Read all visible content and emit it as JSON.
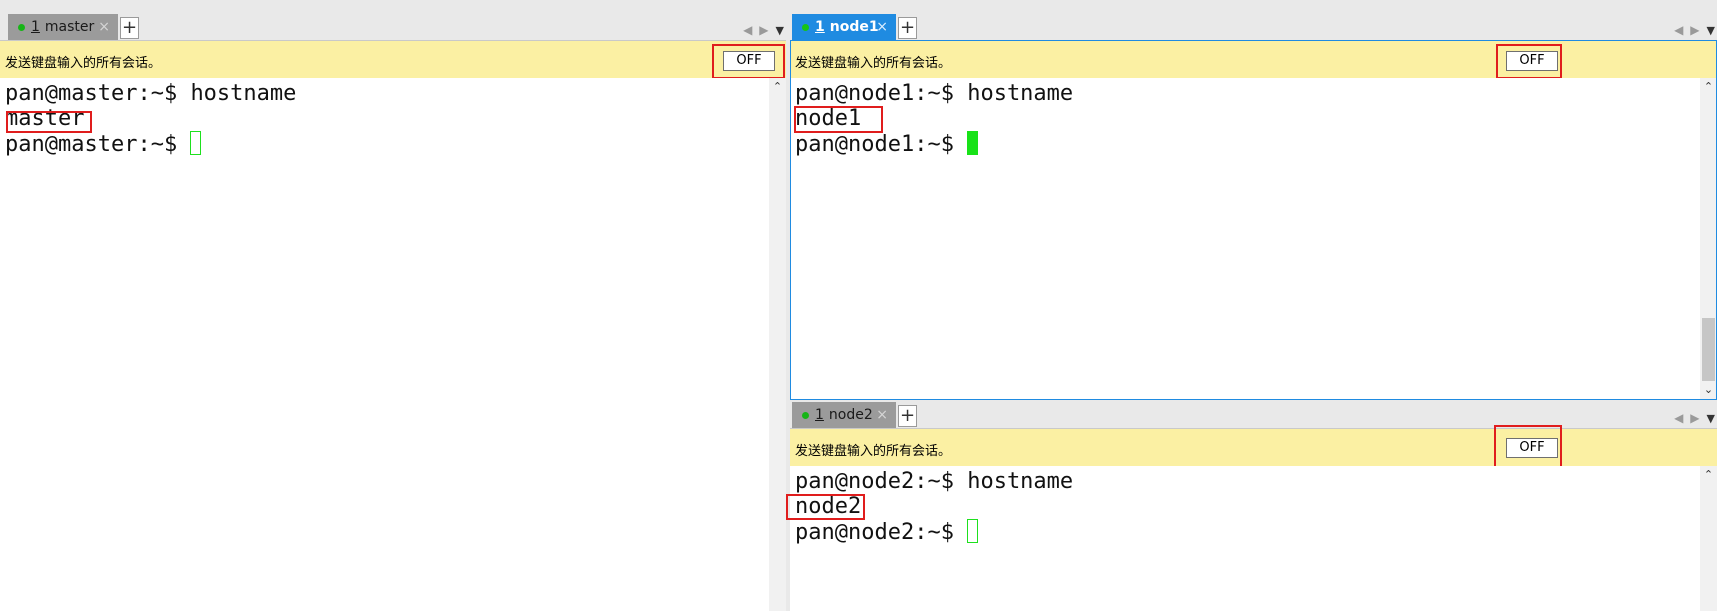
{
  "common": {
    "broadcast_text": "发送键盘输入的所有会话。",
    "off_label": "OFF",
    "add_tab_label": "+",
    "close_label": "×",
    "nav_prev": "◀",
    "nav_next": "▶",
    "nav_menu": "▼",
    "scroll_up": "⌃",
    "scroll_down": "⌄"
  },
  "sessions": [
    {
      "tab": {
        "number": "1",
        "name": "master",
        "active": false,
        "status_color": "#17b517"
      },
      "prompt": "pan@master:~$",
      "command": "hostname",
      "output": "master"
    },
    {
      "tab": {
        "number": "1",
        "name": "node1",
        "active": true,
        "status_color": "#17c417"
      },
      "prompt": "pan@node1:~$",
      "command": "hostname",
      "output": "node1"
    },
    {
      "tab": {
        "number": "1",
        "name": "node2",
        "active": false,
        "status_color": "#17b517"
      },
      "prompt": "pan@node2:~$",
      "command": "hostname",
      "output": "node2"
    }
  ],
  "colors": {
    "broadcast_bg": "#fbf0a3",
    "active_tab": "#1f8be1",
    "inactive_tab": "#9b9b9b",
    "cursor_green": "#18e218",
    "highlight_red": "#e01d1d"
  }
}
